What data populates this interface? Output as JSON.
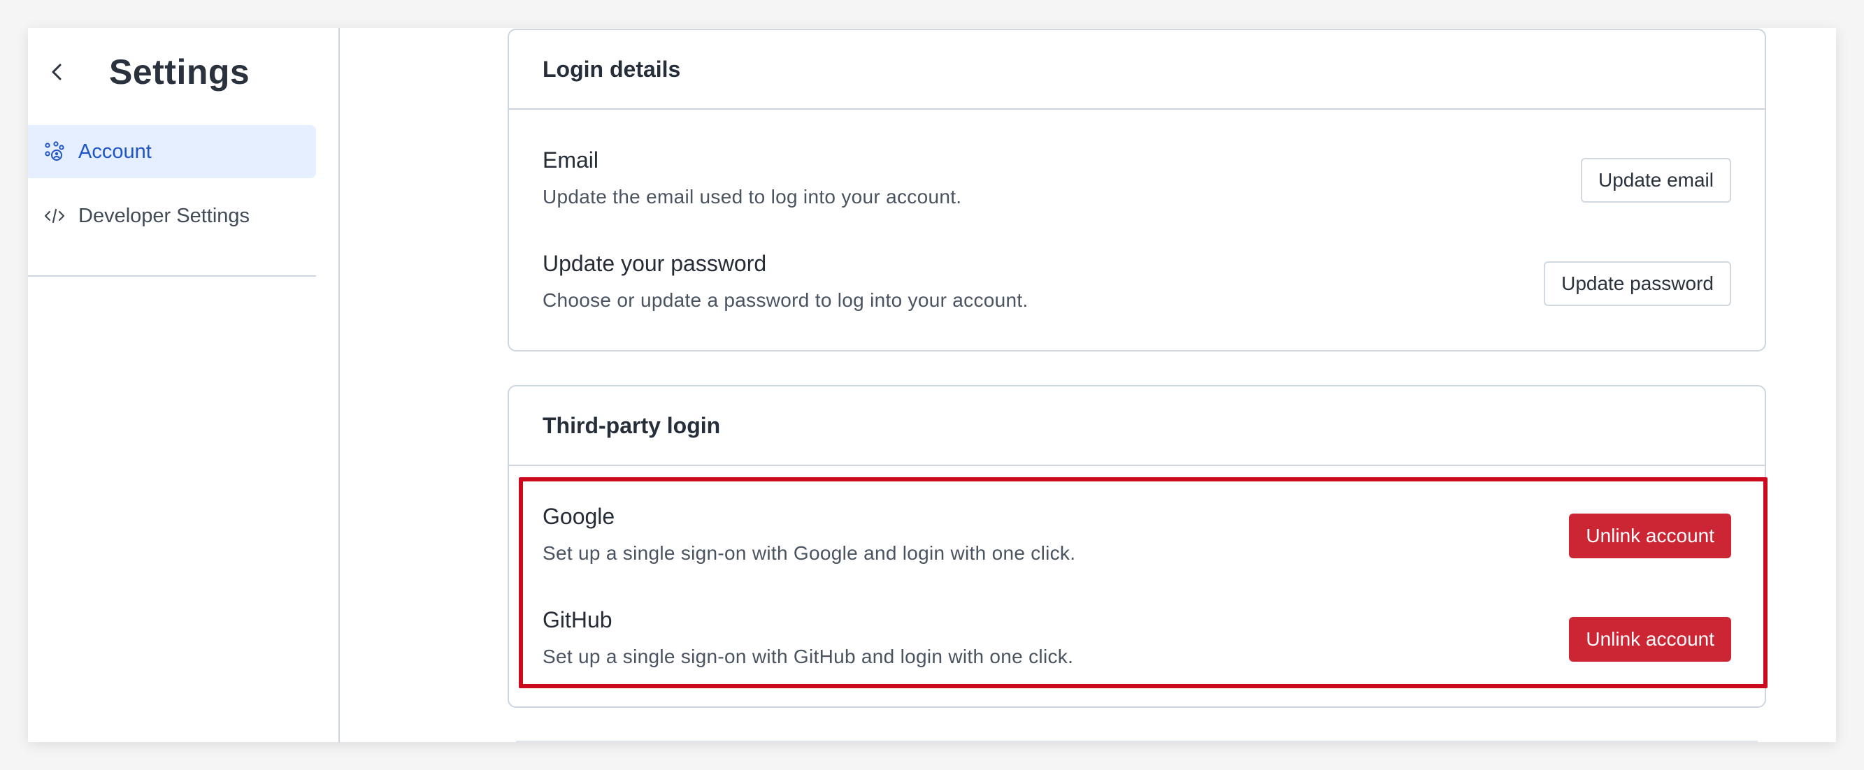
{
  "sidebar": {
    "title": "Settings",
    "items": [
      {
        "label": "Account",
        "icon": "account-dots-icon",
        "active": true
      },
      {
        "label": "Developer Settings",
        "icon": "code-icon",
        "active": false
      }
    ]
  },
  "login_details": {
    "title": "Login details",
    "rows": [
      {
        "title": "Email",
        "description": "Update the email used to log into your account.",
        "button": "Update email"
      },
      {
        "title": "Update your password",
        "description": "Choose or update a password to log into your account.",
        "button": "Update password"
      }
    ]
  },
  "third_party": {
    "title": "Third-party login",
    "rows": [
      {
        "title": "Google",
        "description": "Set up a single sign-on with Google and login with one click.",
        "button": "Unlink account"
      },
      {
        "title": "GitHub",
        "description": "Set up a single sign-on with GitHub and login with one click.",
        "button": "Unlink account"
      }
    ]
  },
  "colors": {
    "accent": "#1e56c8",
    "active_bg": "#e5efff",
    "danger": "#cc2635",
    "highlight": "#cc0a1e",
    "border": "#cdd6e0"
  }
}
